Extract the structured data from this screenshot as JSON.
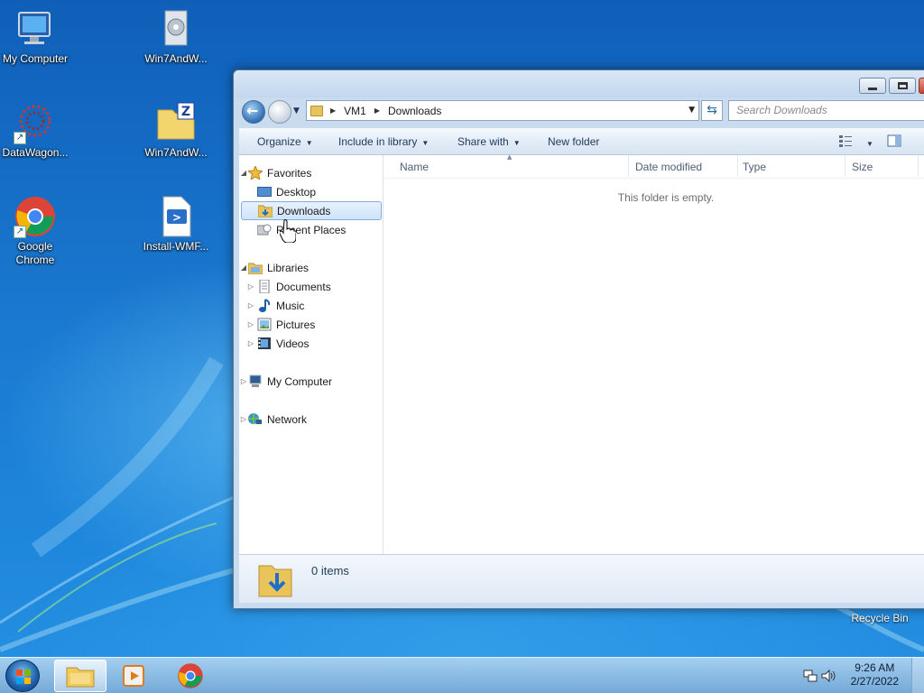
{
  "desktop": {
    "icons": [
      {
        "label": "My Computer",
        "icon": "computer-icon"
      },
      {
        "label": "Win7AndW...",
        "icon": "installer-icon"
      },
      {
        "label": "DataWagon...",
        "icon": "datawagon-icon"
      },
      {
        "label": "Win7AndW...",
        "icon": "zip-folder-icon"
      },
      {
        "label": "Google Chrome",
        "label_line1": "Google",
        "label_line2": "Chrome",
        "icon": "chrome-icon"
      },
      {
        "label": "Install-WMF...",
        "icon": "powershell-script-icon"
      }
    ],
    "recycle_bin": {
      "label": "Recycle Bin",
      "icon": "recycle-bin-icon"
    }
  },
  "explorer": {
    "address": {
      "crumbs": [
        "VM1",
        "Downloads"
      ]
    },
    "search": {
      "placeholder": "Search Downloads"
    },
    "toolbar": {
      "organize": "Organize",
      "include_in_library": "Include in library",
      "share_with": "Share with",
      "new_folder": "New folder"
    },
    "nav": {
      "favorites": "Favorites",
      "desktop": "Desktop",
      "downloads": "Downloads",
      "recent_places": "Recent Places",
      "libraries": "Libraries",
      "documents": "Documents",
      "music": "Music",
      "pictures": "Pictures",
      "videos": "Videos",
      "my_computer": "My Computer",
      "network": "Network"
    },
    "columns": {
      "name": "Name",
      "date_modified": "Date modified",
      "type": "Type",
      "size": "Size"
    },
    "empty_message": "This folder is empty.",
    "details": {
      "count": "0 items"
    }
  },
  "taskbar": {
    "clock": {
      "time": "9:26 AM",
      "date": "2/27/2022"
    }
  },
  "colors": {
    "selection_bg": "#cfe4fa",
    "selection_border": "#84acdd",
    "toolbar_text": "#1e395b"
  }
}
